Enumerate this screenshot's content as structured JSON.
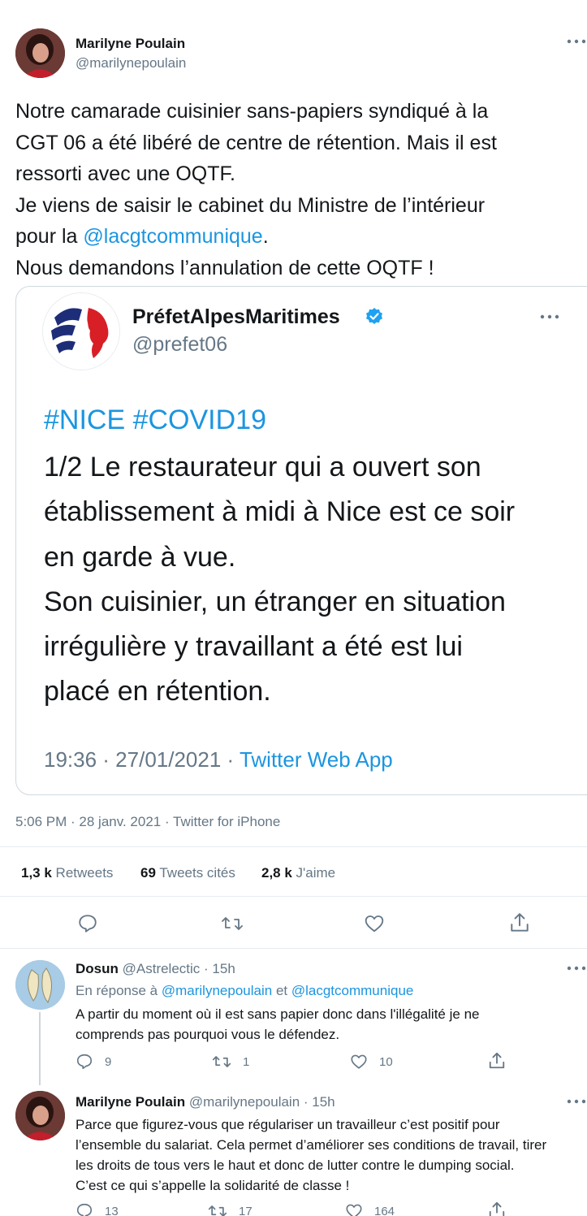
{
  "tweet": {
    "author_name": "Marilyne Poulain",
    "author_handle": "@marilynepoulain",
    "text_lines": [
      "Notre camarade cuisinier sans-papiers syndiqué à la",
      "CGT 06 a été libéré de centre de rétention. Mais il est",
      "ressorti avec une OQTF.",
      "Je viens de saisir le cabinet du Ministre  de l’intérieur"
    ],
    "line5_prefix": "pour la ",
    "mention": "@lacgtcommunique",
    "line5_suffix": ".",
    "line6": "Nous demandons l’annulation de cette OQTF !",
    "timestamp": "5:06 PM · 28 janv. 2021 · Twitter for iPhone",
    "stats": {
      "retweets_count": "1,3 k",
      "retweets_label": "Retweets",
      "quotes_count": "69",
      "quotes_label": "Tweets cités",
      "likes_count": "2,8 k",
      "likes_label": "J'aime"
    }
  },
  "quoted": {
    "author_name": "PréfetAlpesMaritimes",
    "author_handle": "@prefet06",
    "hashtags": "#NICE #COVID19",
    "text_lines": [
      "1/2 Le restaurateur qui a ouvert son",
      "établissement à midi à Nice est ce soir",
      "en garde à vue.",
      "Son cuisinier, un étranger en situation",
      "irrégulière y travaillant a été est lui",
      "placé en rétention."
    ],
    "time_prefix": "19:36 · 27/01/2021 · ",
    "source": "Twitter Web App"
  },
  "replies": [
    {
      "author_name": "Dosun",
      "author_handle": "@Astrelectic",
      "time": "· 15h",
      "reply_to_label": "En réponse à",
      "reply_to_1": "@marilynepoulain",
      "reply_to_and": "et",
      "reply_to_2": "@lacgtcommunique",
      "text_lines": [
        "A partir du moment où il est sans papier donc dans l'illégalité je ne",
        "comprends pas pourquoi vous le défendez."
      ],
      "reply_count": "9",
      "retweet_count": "1",
      "like_count": "10"
    },
    {
      "author_name": "Marilyne Poulain",
      "author_handle": "@marilynepoulain",
      "time": "· 15h",
      "text_lines": [
        "Parce que figurez-vous que régulariser un travailleur c’est positif pour",
        "l’ensemble du salariat. Cela permet d’améliorer ses conditions de travail, tirer",
        "les droits de tous vers le haut et donc de lutter contre le dumping social.",
        "C’est ce qui s’appelle la solidarité de classe !"
      ],
      "reply_count": "13",
      "retweet_count": "17",
      "like_count": "164"
    }
  ],
  "icons": {
    "more": "more-horizontal-icon",
    "reply": "reply-icon",
    "retweet": "retweet-icon",
    "like": "heart-icon",
    "share": "share-icon",
    "verified": "verified-badge-icon"
  },
  "colors": {
    "link": "#1b95e0",
    "muted": "#657786",
    "text": "#14171a",
    "verified": "#1da1f2",
    "divider": "#e6ecf0"
  }
}
